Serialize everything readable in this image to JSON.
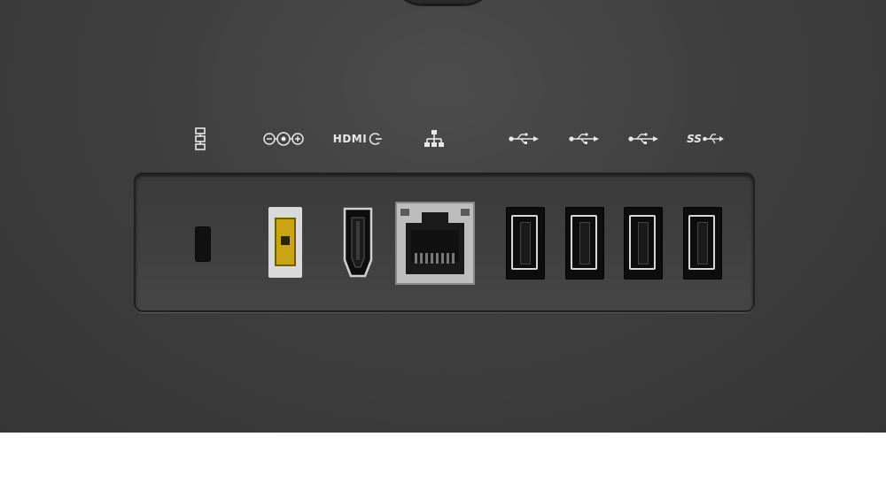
{
  "device": {
    "ports": [
      {
        "name": "kensington-lock-slot",
        "label_icon": "lock-icon"
      },
      {
        "name": "dc-power-input",
        "label_icon": "dc-power-icon",
        "port_color": "#c9a414"
      },
      {
        "name": "hdmi-port",
        "label_icon": "hdmi-icon",
        "label_text": "HDMI"
      },
      {
        "name": "ethernet-port",
        "label_icon": "network-icon"
      },
      {
        "name": "usb-port",
        "label_icon": "usb-icon"
      },
      {
        "name": "usb-port",
        "label_icon": "usb-icon"
      },
      {
        "name": "usb-port",
        "label_icon": "usb-icon"
      },
      {
        "name": "usb-3-port",
        "label_icon": "usb-superspeed-icon",
        "label_text": "SS"
      }
    ],
    "colors": {
      "chassis": "#3f3f3f",
      "panel": "#3a3a3a",
      "power_port_accent": "#c9a414",
      "background": "#ffffff"
    }
  }
}
